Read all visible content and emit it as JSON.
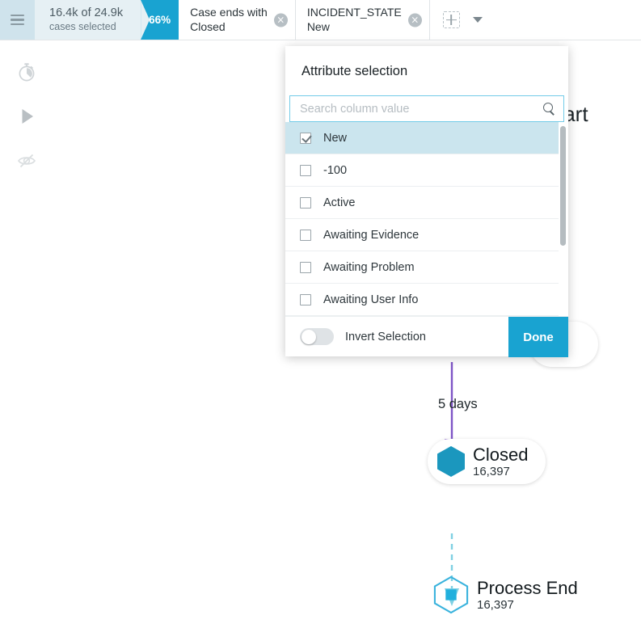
{
  "header": {
    "menu_icon": "hamburger-icon",
    "cases_primary": "16.4k of 24.9k",
    "cases_secondary": "cases selected",
    "percent_badge": "66%",
    "filters": [
      {
        "line1": "Case ends with",
        "line2": "Closed",
        "close_glyph": "×"
      },
      {
        "line1": "INCIDENT_STATE",
        "line2": "New",
        "close_glyph": "×"
      }
    ],
    "add_filter_icon": "dashed-square-plus-icon",
    "more_icon": "chevron-down-icon"
  },
  "rail": {
    "items": [
      {
        "name": "stopwatch-icon"
      },
      {
        "name": "play-icon"
      },
      {
        "name": "eye-off-icon"
      }
    ]
  },
  "canvas": {
    "start_label": "tart",
    "edges": [
      {
        "label": "5 days",
        "color": "#7e55c6",
        "style": "solid"
      },
      {
        "label": "",
        "color": "#7fd0e3",
        "style": "dashed"
      }
    ],
    "nodes": [
      {
        "name": "Closed",
        "count": "16,397",
        "marker": "hex-filled"
      },
      {
        "name": "Process End",
        "count": "16,397",
        "marker": "hex-outline-square"
      }
    ]
  },
  "popup": {
    "title": "Attribute selection",
    "search": {
      "placeholder": "Search column value",
      "value": "",
      "icon": "search-icon"
    },
    "options": [
      {
        "label": "New",
        "checked": true
      },
      {
        "label": "-100",
        "checked": false
      },
      {
        "label": "Active",
        "checked": false
      },
      {
        "label": "Awaiting Evidence",
        "checked": false
      },
      {
        "label": "Awaiting Problem",
        "checked": false
      },
      {
        "label": "Awaiting User Info",
        "checked": false
      }
    ],
    "invert_label": "Invert Selection",
    "invert_on": false,
    "done_label": "Done"
  },
  "colors": {
    "accent": "#19a3d1",
    "node_teal": "#1b97be",
    "edge_purple": "#7e55c6",
    "edge_cyan": "#7fd0e3",
    "selected_row": "#cbe5ee"
  }
}
